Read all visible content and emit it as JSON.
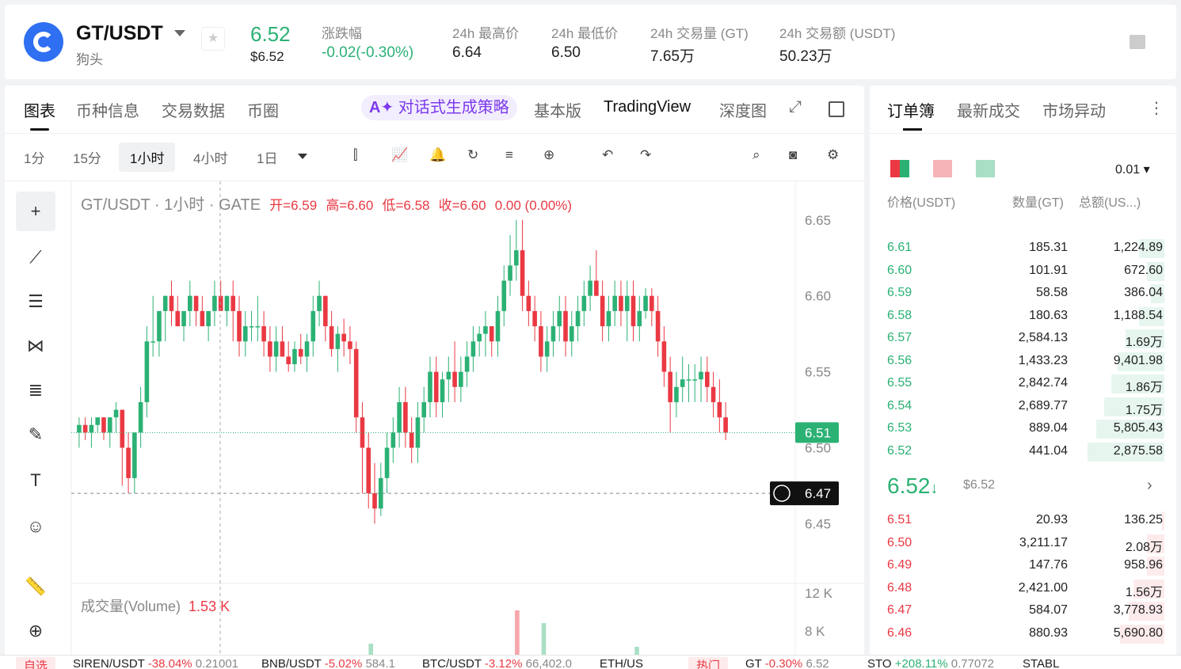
{
  "header": {
    "pair": "GT/USDT",
    "name": "狗头",
    "price": "6.52",
    "price_usd": "$6.52",
    "stats": [
      {
        "label": "涨跌幅",
        "value": "-0.02(-0.30%)"
      },
      {
        "label": "24h 最高价",
        "value": "6.64"
      },
      {
        "label": "24h 最低价",
        "value": "6.50"
      },
      {
        "label": "24h 交易量 (GT)",
        "value": "7.65万"
      },
      {
        "label": "24h 交易额 (USDT)",
        "value": "50.23万"
      }
    ]
  },
  "chart_tabs": [
    "图表",
    "币种信息",
    "交易数据",
    "币圈"
  ],
  "ai_tab": "对话式生成策略",
  "view_tabs": [
    "基本版",
    "TradingView",
    "深度图"
  ],
  "intervals": [
    "1分",
    "15分",
    "1小时",
    "4小时",
    "1日"
  ],
  "legend": {
    "title": "GT/USDT · 1小时 · GATE",
    "open": "开=6.59",
    "high": "高=6.60",
    "low": "低=6.58",
    "close": "收=6.60",
    "change": "0.00 (0.00%)"
  },
  "volume": {
    "label": "成交量(Volume)",
    "value": "1.53 K"
  },
  "price_axis": [
    "6.65",
    "6.60",
    "6.55",
    "6.50",
    "6.45"
  ],
  "vol_axis": [
    "12 K",
    "8 K"
  ],
  "last_price_tag": "6.51",
  "cursor_tag": "6.47",
  "colors": {
    "up": "#2bb174",
    "down": "#ea3943"
  },
  "chart_data": {
    "type": "candlestick",
    "y_range": [
      6.42,
      6.665
    ],
    "candles": [
      [
        6.51,
        6.52,
        6.5,
        6.515
      ],
      [
        6.515,
        6.52,
        6.505,
        6.51
      ],
      [
        6.51,
        6.52,
        6.5,
        6.515
      ],
      [
        6.515,
        6.52,
        6.51,
        6.52
      ],
      [
        6.52,
        6.52,
        6.505,
        6.51
      ],
      [
        6.51,
        6.52,
        6.5,
        6.52
      ],
      [
        6.52,
        6.53,
        6.51,
        6.525
      ],
      [
        6.525,
        6.525,
        6.475,
        6.5
      ],
      [
        6.5,
        6.51,
        6.47,
        6.48
      ],
      [
        6.48,
        6.51,
        6.47,
        6.51
      ],
      [
        6.51,
        6.54,
        6.5,
        6.53
      ],
      [
        6.53,
        6.58,
        6.52,
        6.57
      ],
      [
        6.57,
        6.6,
        6.56,
        6.57
      ],
      [
        6.57,
        6.58,
        6.56,
        6.59
      ],
      [
        6.59,
        6.6,
        6.57,
        6.6
      ],
      [
        6.6,
        6.61,
        6.58,
        6.59
      ],
      [
        6.59,
        6.6,
        6.58,
        6.58
      ],
      [
        6.58,
        6.59,
        6.57,
        6.59
      ],
      [
        6.59,
        6.61,
        6.58,
        6.6
      ],
      [
        6.6,
        6.6,
        6.58,
        6.59
      ],
      [
        6.59,
        6.6,
        6.58,
        6.58
      ],
      [
        6.58,
        6.59,
        6.57,
        6.59
      ],
      [
        6.59,
        6.61,
        6.58,
        6.6
      ],
      [
        6.6,
        6.61,
        6.59,
        6.59
      ],
      [
        6.59,
        6.6,
        6.58,
        6.6
      ],
      [
        6.6,
        6.61,
        6.57,
        6.59
      ],
      [
        6.59,
        6.6,
        6.56,
        6.57
      ],
      [
        6.57,
        6.59,
        6.56,
        6.58
      ],
      [
        6.58,
        6.59,
        6.57,
        6.58
      ],
      [
        6.58,
        6.6,
        6.57,
        6.58
      ],
      [
        6.58,
        6.59,
        6.56,
        6.57
      ],
      [
        6.57,
        6.58,
        6.55,
        6.56
      ],
      [
        6.56,
        6.58,
        6.55,
        6.57
      ],
      [
        6.57,
        6.58,
        6.56,
        6.56
      ],
      [
        6.56,
        6.57,
        6.55,
        6.555
      ],
      [
        6.555,
        6.57,
        6.55,
        6.565
      ],
      [
        6.565,
        6.575,
        6.555,
        6.56
      ],
      [
        6.56,
        6.575,
        6.55,
        6.57
      ],
      [
        6.57,
        6.6,
        6.56,
        6.59
      ],
      [
        6.59,
        6.61,
        6.58,
        6.6
      ],
      [
        6.6,
        6.6,
        6.57,
        6.58
      ],
      [
        6.58,
        6.59,
        6.56,
        6.565
      ],
      [
        6.565,
        6.58,
        6.55,
        6.575
      ],
      [
        6.575,
        6.585,
        6.56,
        6.57
      ],
      [
        6.57,
        6.58,
        6.555,
        6.565
      ],
      [
        6.565,
        6.57,
        6.51,
        6.52
      ],
      [
        6.52,
        6.53,
        6.47,
        6.5
      ],
      [
        6.5,
        6.51,
        6.46,
        6.47
      ],
      [
        6.47,
        6.49,
        6.45,
        6.46
      ],
      [
        6.46,
        6.49,
        6.455,
        6.48
      ],
      [
        6.48,
        6.51,
        6.47,
        6.5
      ],
      [
        6.5,
        6.52,
        6.49,
        6.51
      ],
      [
        6.51,
        6.54,
        6.5,
        6.53
      ],
      [
        6.53,
        6.54,
        6.5,
        6.51
      ],
      [
        6.51,
        6.52,
        6.49,
        6.5
      ],
      [
        6.5,
        6.53,
        6.49,
        6.52
      ],
      [
        6.52,
        6.54,
        6.51,
        6.53
      ],
      [
        6.53,
        6.56,
        6.52,
        6.55
      ],
      [
        6.55,
        6.56,
        6.52,
        6.53
      ],
      [
        6.53,
        6.55,
        6.52,
        6.545
      ],
      [
        6.545,
        6.56,
        6.53,
        6.55
      ],
      [
        6.55,
        6.57,
        6.53,
        6.54
      ],
      [
        6.54,
        6.56,
        6.53,
        6.55
      ],
      [
        6.55,
        6.57,
        6.54,
        6.56
      ],
      [
        6.56,
        6.58,
        6.55,
        6.57
      ],
      [
        6.57,
        6.58,
        6.56,
        6.575
      ],
      [
        6.575,
        6.59,
        6.56,
        6.58
      ],
      [
        6.58,
        6.58,
        6.56,
        6.57
      ],
      [
        6.57,
        6.6,
        6.56,
        6.59
      ],
      [
        6.59,
        6.62,
        6.58,
        6.61
      ],
      [
        6.61,
        6.64,
        6.6,
        6.62
      ],
      [
        6.62,
        6.65,
        6.61,
        6.63
      ],
      [
        6.63,
        6.65,
        6.59,
        6.6
      ],
      [
        6.6,
        6.61,
        6.58,
        6.59
      ],
      [
        6.59,
        6.6,
        6.57,
        6.58
      ],
      [
        6.58,
        6.59,
        6.55,
        6.56
      ],
      [
        6.56,
        6.58,
        6.55,
        6.57
      ],
      [
        6.57,
        6.59,
        6.56,
        6.58
      ],
      [
        6.58,
        6.6,
        6.57,
        6.59
      ],
      [
        6.59,
        6.6,
        6.56,
        6.57
      ],
      [
        6.57,
        6.59,
        6.56,
        6.58
      ],
      [
        6.58,
        6.6,
        6.57,
        6.59
      ],
      [
        6.59,
        6.61,
        6.58,
        6.6
      ],
      [
        6.6,
        6.62,
        6.59,
        6.61
      ],
      [
        6.61,
        6.63,
        6.6,
        6.6
      ],
      [
        6.6,
        6.61,
        6.57,
        6.58
      ],
      [
        6.58,
        6.6,
        6.57,
        6.59
      ],
      [
        6.59,
        6.61,
        6.58,
        6.6
      ],
      [
        6.6,
        6.61,
        6.58,
        6.59
      ],
      [
        6.59,
        6.61,
        6.57,
        6.6
      ],
      [
        6.6,
        6.61,
        6.57,
        6.58
      ],
      [
        6.58,
        6.6,
        6.57,
        6.59
      ],
      [
        6.59,
        6.605,
        6.585,
        6.6
      ],
      [
        6.6,
        6.605,
        6.58,
        6.59
      ],
      [
        6.59,
        6.6,
        6.56,
        6.57
      ],
      [
        6.57,
        6.58,
        6.54,
        6.55
      ],
      [
        6.55,
        6.56,
        6.51,
        6.53
      ],
      [
        6.53,
        6.55,
        6.52,
        6.54
      ],
      [
        6.54,
        6.56,
        6.53,
        6.545
      ],
      [
        6.545,
        6.555,
        6.53,
        6.545
      ],
      [
        6.545,
        6.555,
        6.53,
        6.545
      ],
      [
        6.545,
        6.56,
        6.53,
        6.55
      ],
      [
        6.55,
        6.56,
        6.53,
        6.54
      ],
      [
        6.54,
        6.55,
        6.52,
        6.53
      ],
      [
        6.53,
        6.545,
        6.51,
        6.52
      ],
      [
        6.52,
        6.53,
        6.505,
        6.51
      ]
    ]
  },
  "orderbook": {
    "tabs": [
      "订单簿",
      "最新成交",
      "市场异动"
    ],
    "precision": "0.01",
    "headers": [
      "价格(USDT)",
      "数量(GT)",
      "总额(US...)"
    ],
    "asks": [
      [
        "6.61",
        "185.31",
        "1,224.89",
        0.3
      ],
      [
        "6.60",
        "101.91",
        "672.60",
        0.2
      ],
      [
        "6.59",
        "58.58",
        "386.04",
        0.16
      ],
      [
        "6.58",
        "180.63",
        "1,188.54",
        0.3
      ],
      [
        "6.57",
        "2,584.13",
        "1.69万",
        0.45
      ],
      [
        "6.56",
        "1,433.23",
        "9,401.98",
        0.55
      ],
      [
        "6.55",
        "2,842.74",
        "1.86万",
        0.62
      ],
      [
        "6.54",
        "2,689.77",
        "1.75万",
        0.7
      ],
      [
        "6.53",
        "889.04",
        "5,805.43",
        0.8
      ],
      [
        "6.52",
        "441.04",
        "2,875.58",
        0.9
      ]
    ],
    "mid": {
      "price": "6.52",
      "usd": "$6.52"
    },
    "bids": [
      [
        "6.51",
        "20.93",
        "136.25",
        0.03
      ],
      [
        "6.50",
        "3,211.17",
        "2.08万",
        0.2
      ],
      [
        "6.49",
        "147.76",
        "958.96",
        0.2
      ],
      [
        "6.48",
        "2,421.00",
        "1.56万",
        0.36
      ],
      [
        "6.47",
        "584.07",
        "3,778.93",
        0.42
      ],
      [
        "6.46",
        "880.93",
        "5,690.80",
        0.52
      ]
    ]
  },
  "ticker": [
    {
      "tag": "自选"
    },
    {
      "pair": "SIREN/USDT",
      "chg": "-38.04%",
      "px": "0.21001"
    },
    {
      "pair": "BNB/USDT",
      "chg": "-5.02%",
      "px": "584.1"
    },
    {
      "pair": "BTC/USDT",
      "chg": "-3.12%",
      "px": "66,402.0"
    },
    {
      "pair": "ETH/US",
      "chg": "",
      "px": ""
    },
    {
      "tag": "热门"
    },
    {
      "pair": "GT",
      "chg": "-0.30%",
      "px": "6.52"
    },
    {
      "pair": "STO",
      "chg": "+208.11%",
      "px": "0.77072"
    },
    {
      "pair": "STABL",
      "chg": "",
      "px": ""
    }
  ]
}
